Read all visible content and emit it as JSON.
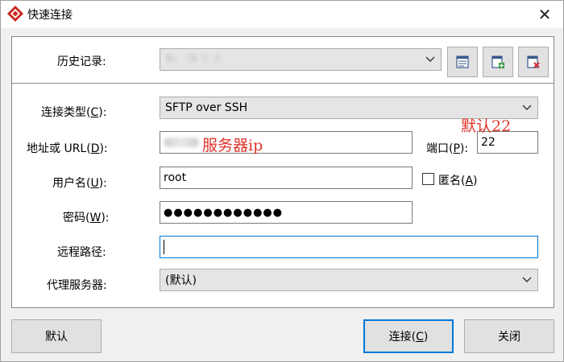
{
  "window": {
    "title": "快速连接",
    "close_glyph": "✕"
  },
  "history": {
    "label": "历史记录",
    "label_key": "",
    "label_suffix": ":",
    "value": ""
  },
  "form": {
    "conn_type": {
      "label_pre": "连接类型(",
      "key": "C",
      "label_post": "):",
      "value": "SFTP over SSH"
    },
    "host": {
      "label_pre": "地址或 URL(",
      "key": "D",
      "label_post": "):",
      "value": ""
    },
    "port": {
      "label_pre": "端口(",
      "key": "P",
      "label_post": "):",
      "value": "22"
    },
    "username": {
      "label_pre": "用户名(",
      "key": "U",
      "label_post": "):",
      "value": "root"
    },
    "anonymous": {
      "label_pre": "匿名(",
      "key": "A",
      "label_post": ")",
      "checked": false
    },
    "password": {
      "label_pre": "密码(",
      "key": "W",
      "label_post": "):",
      "value": "●●●●●●●●●●●●"
    },
    "remote_path": {
      "label": "远程路径:",
      "value": ""
    },
    "proxy": {
      "label": "代理服务器:",
      "value": "(默认)"
    }
  },
  "annotations": {
    "server_ip": "服务器ip",
    "default_port": "默认22"
  },
  "buttons": {
    "default_label": "默认",
    "connect_pre": "连接(",
    "connect_key": "C",
    "connect_post": ")",
    "close_label": "关闭"
  },
  "colors": {
    "annotation": "#e0342b",
    "focus": "#0078d7"
  }
}
